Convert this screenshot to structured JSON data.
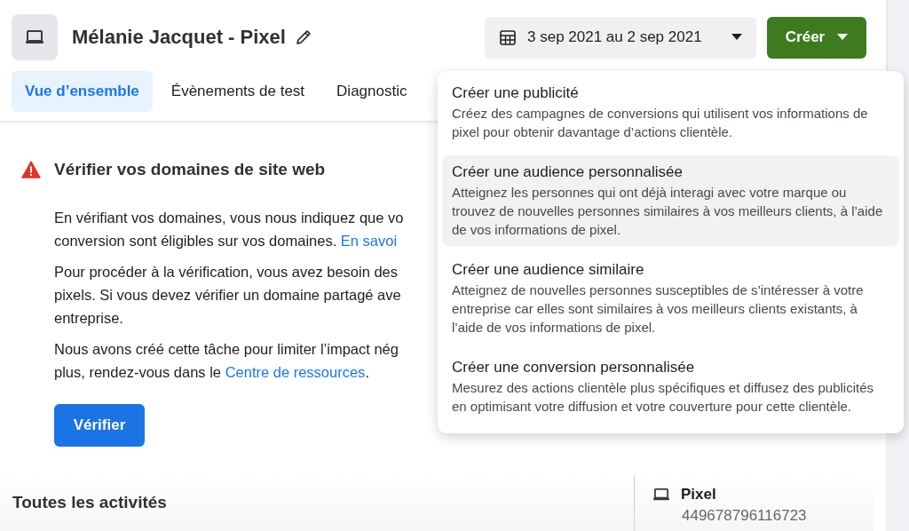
{
  "header": {
    "title": "Mélanie Jacquet - Pixel",
    "date_range": "3 sep 2021 au 2 sep 2021",
    "create_button": "Créer"
  },
  "tabs": [
    {
      "label": "Vue d’ensemble",
      "selected": true
    },
    {
      "label": "Évènements de test",
      "selected": false
    },
    {
      "label": "Diagnostic",
      "selected": false
    }
  ],
  "alert": {
    "title": "Vérifier vos domaines de site web",
    "paragraphs": [
      [
        [
          {
            "kind": "text",
            "text": "En vérifiant vos domaines, vous nous indiquez que vo"
          }
        ],
        [
          {
            "kind": "text",
            "text": "conversion sont éligibles sur vos domaines. "
          },
          {
            "kind": "link",
            "text": "En savoi"
          }
        ]
      ],
      [
        [
          {
            "kind": "text",
            "text": "Pour procéder à la vérification, vous avez besoin des"
          }
        ],
        [
          {
            "kind": "text",
            "text": "pixels. Si vous devez vérifier un domaine partagé ave"
          }
        ],
        [
          {
            "kind": "text",
            "text": "entreprise."
          }
        ]
      ],
      [
        [
          {
            "kind": "text",
            "text": "Nous avons créé cette tâche pour limiter l’impact nég"
          }
        ],
        [
          {
            "kind": "text",
            "text": "plus, rendez-vous dans le "
          },
          {
            "kind": "link",
            "text": "Centre de ressources"
          },
          {
            "kind": "text",
            "text": "."
          }
        ]
      ]
    ],
    "button": "Vérifier"
  },
  "activities_title": "Toutes les activités",
  "pixel_info": {
    "name": "Pixel",
    "id": "449678796116723"
  },
  "create_menu": [
    {
      "title": "Créer une publicité",
      "description": "Créez des campagnes de conversions qui utilisent vos informations de pixel pour obtenir davantage d’actions clientèle.",
      "highlighted": false
    },
    {
      "title": "Créer une audience personnalisée",
      "description": "Atteignez les personnes qui ont déjà interagi avec votre marque ou trouvez de nouvelles personnes similaires à vos meilleurs clients, à l’aide de vos informations de pixel.",
      "highlighted": true
    },
    {
      "title": "Créer une audience similaire",
      "description": "Atteignez de nouvelles personnes susceptibles de s’intéresser à votre entreprise car elles sont similaires à vos meilleurs clients existants, à l’aide de vos informations de pixel.",
      "highlighted": false
    },
    {
      "title": "Créer une conversion personnalisée",
      "description": "Mesurez des actions clientèle plus spécifiques et diffusez des publicités en optimisant votre diffusion et votre couverture pour cette clientèle.",
      "highlighted": false
    }
  ]
}
